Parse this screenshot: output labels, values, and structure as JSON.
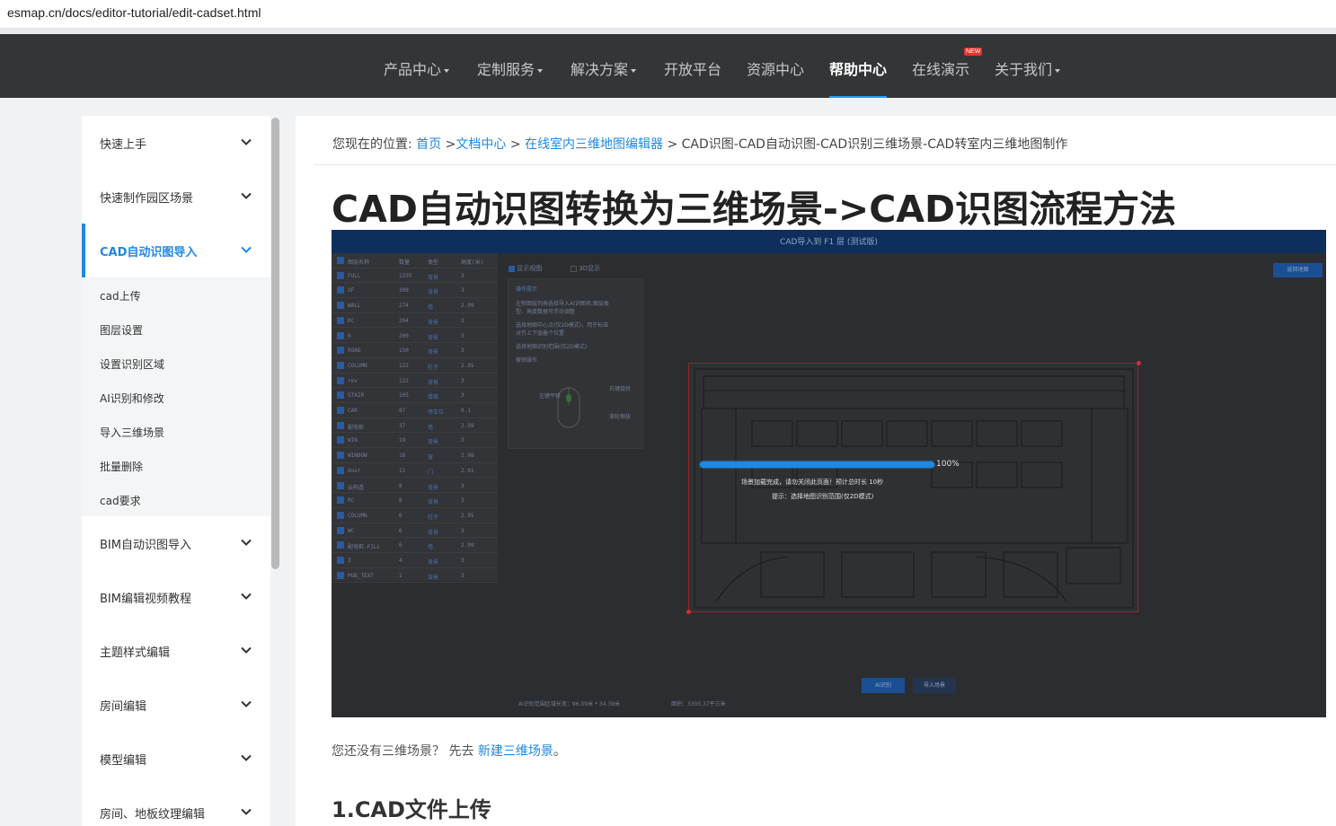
{
  "browser": {
    "url": "esmap.cn/docs/editor-tutorial/edit-cadset.html"
  },
  "nav": {
    "items": [
      {
        "label": "产品中心",
        "caret": true
      },
      {
        "label": "定制服务",
        "caret": true
      },
      {
        "label": "解决方案",
        "caret": true
      },
      {
        "label": "开放平台",
        "caret": false
      },
      {
        "label": "资源中心",
        "caret": false
      },
      {
        "label": "帮助中心",
        "caret": false,
        "active": true
      },
      {
        "label": "在线演示",
        "caret": false,
        "badge": "NEW"
      },
      {
        "label": "关于我们",
        "caret": true
      }
    ]
  },
  "sidebar": {
    "items": [
      {
        "label": "快速上手"
      },
      {
        "label": "快速制作园区场景"
      },
      {
        "label": "CAD自动识图导入",
        "active": true
      },
      {
        "label": "BIM自动识图导入"
      },
      {
        "label": "BIM编辑视频教程"
      },
      {
        "label": "主题样式编辑"
      },
      {
        "label": "房间编辑"
      },
      {
        "label": "模型编辑"
      },
      {
        "label": "房间、地板纹理编辑"
      }
    ],
    "subitems": [
      "cad上传",
      "图层设置",
      "设置识别区域",
      "AI识别和修改",
      "导入三维场景",
      "批量删除",
      "cad要求"
    ]
  },
  "breadcrumb": {
    "prefix": "您现在的位置:",
    "home": "首页",
    "sep": ">",
    "docs": "文档中心",
    "editor": "在线室内三维地图编辑器",
    "current": "CAD识图-CAD自动识图-CAD识别三维场景-CAD转室内三维地图制作"
  },
  "page": {
    "title": "CAD自动识图转换为三维场景->CAD识图流程方法",
    "intro_prefix": "您还没有三维场景？  先去",
    "intro_link": "新建三维场景",
    "intro_suffix": "。",
    "section1": "1.CAD文件上传"
  },
  "screenshot": {
    "header": "CAD导入到 F1 层 (测试版)",
    "table_header": [
      "图层名称",
      "数量",
      "类型",
      "高度(米)"
    ],
    "rows": [
      [
        "FULL",
        "1335",
        "背景",
        "3"
      ],
      [
        "XF",
        "308",
        "背景",
        "3"
      ],
      [
        "WALL",
        "274",
        "墙",
        "2.99"
      ],
      [
        "RC",
        "204",
        "背景",
        "3"
      ],
      [
        "0",
        "200",
        "背景",
        "3"
      ],
      [
        "ROAD",
        "150",
        "背景",
        "3"
      ],
      [
        "COLUMN",
        "122",
        "柱子",
        "2.95"
      ],
      [
        "rev",
        "122",
        "背景",
        "3"
      ],
      [
        "STAIR",
        "105",
        "楼梯",
        "3"
      ],
      [
        "CAR",
        "87",
        "停车位",
        "0.1"
      ],
      [
        "配电柜",
        "37",
        "墙",
        "2.99"
      ],
      [
        "WIN",
        "19",
        "背景",
        "3"
      ],
      [
        "WINDOW",
        "18",
        "窗",
        "2.98"
      ],
      [
        "door",
        "11",
        "门",
        "2.91"
      ],
      [
        "云构造",
        "8",
        "背景",
        "3"
      ],
      [
        "RC",
        "8",
        "背景",
        "3"
      ],
      [
        "COLUMN",
        "6",
        "柱子",
        "2.95"
      ],
      [
        "WC",
        "6",
        "背景",
        "3"
      ],
      [
        "配电柜-FILL",
        "6",
        "墙",
        "2.99"
      ],
      [
        "3",
        "4",
        "背景",
        "3"
      ],
      [
        "PUB_TEXT",
        "1",
        "背景",
        "3"
      ]
    ],
    "panel_tabs": [
      "显示视图",
      "3D显示"
    ],
    "panel_title": "操作提示",
    "panel_lines": [
      "左侧图层列表选择导入AI识图项,图层类",
      "型、高度数据可手动调整",
      "选择地图中心点(仅2D模式)，用于标准",
      "对齐上下层叠个位置",
      "选择地图识别范围(仅2D模式)",
      "撤销操作"
    ],
    "mouse_labels": [
      "左键平移",
      "右键旋转",
      "滚轮缩放"
    ],
    "top_button": "返回地图",
    "progress_pct": "100%",
    "progress_value": 1.0,
    "message1": "场景加载完成，请勿关闭此页面！预计总时长 10秒",
    "message2": "提示：选择地图识别范围(仅2D模式)",
    "btn_primary": "AI识别",
    "btn_secondary": "导入场景",
    "footer_left": "AI识别范围区域长宽：96.09米 * 34.39米",
    "footer_right": "面积：3305.37平方米"
  }
}
